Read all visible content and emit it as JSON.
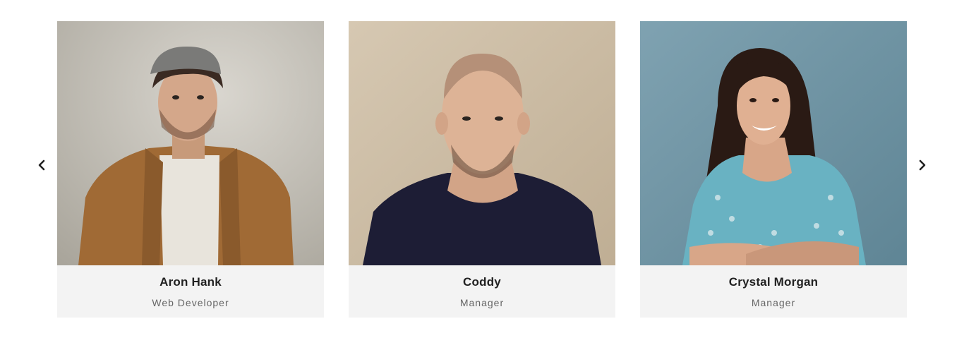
{
  "carousel": {
    "prev_icon": "chevron-left-icon",
    "next_icon": "chevron-right-icon",
    "members": [
      {
        "name": "Aron Hank",
        "role": "Web Developer",
        "photo_bg": "#c9c5bb"
      },
      {
        "name": "Coddy",
        "role": "Manager",
        "photo_bg": "#cdbfa8"
      },
      {
        "name": "Crystal Morgan",
        "role": "Manager",
        "photo_bg": "#6f93a3"
      }
    ]
  },
  "colors": {
    "card_bg": "#f3f3f3",
    "name_text": "#222222",
    "role_text": "#666666"
  }
}
